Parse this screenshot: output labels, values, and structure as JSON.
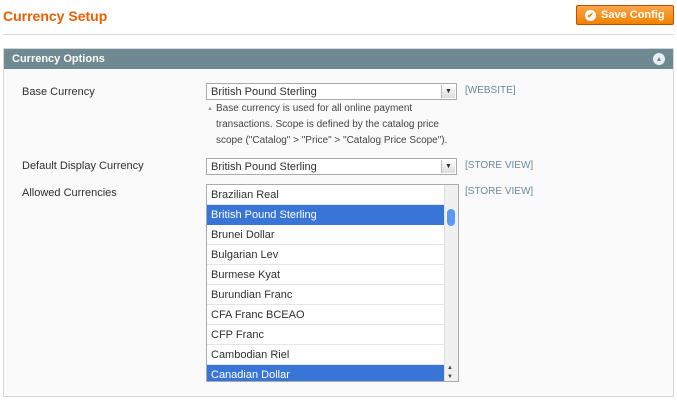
{
  "page": {
    "title": "Currency Setup"
  },
  "toolbar": {
    "save_label": "Save Config"
  },
  "section": {
    "title": "Currency Options",
    "base": {
      "label": "Base Currency",
      "value": "British Pound Sterling",
      "scope": "[WEBSITE]",
      "hint": "Base currency is used for all online payment transactions. Scope is defined by the catalog price scope (\"Catalog\" > \"Price\" > \"Catalog Price Scope\")."
    },
    "display": {
      "label": "Default Display Currency",
      "value": "British Pound Sterling",
      "scope": "[STORE VIEW]"
    },
    "allowed": {
      "label": "Allowed Currencies",
      "scope": "[STORE VIEW]",
      "options": [
        {
          "label": "Brazilian Real",
          "selected": false
        },
        {
          "label": "British Pound Sterling",
          "selected": true
        },
        {
          "label": "Brunei Dollar",
          "selected": false
        },
        {
          "label": "Bulgarian Lev",
          "selected": false
        },
        {
          "label": "Burmese Kyat",
          "selected": false
        },
        {
          "label": "Burundian Franc",
          "selected": false
        },
        {
          "label": "CFA Franc BCEAO",
          "selected": false
        },
        {
          "label": "CFP Franc",
          "selected": false
        },
        {
          "label": "Cambodian Riel",
          "selected": false
        },
        {
          "label": "Canadian Dollar",
          "selected": true
        }
      ]
    }
  },
  "colors": {
    "title": "#eb5e00",
    "header": "#6f8992",
    "selected": "#3875d7",
    "button": "#f18200"
  }
}
